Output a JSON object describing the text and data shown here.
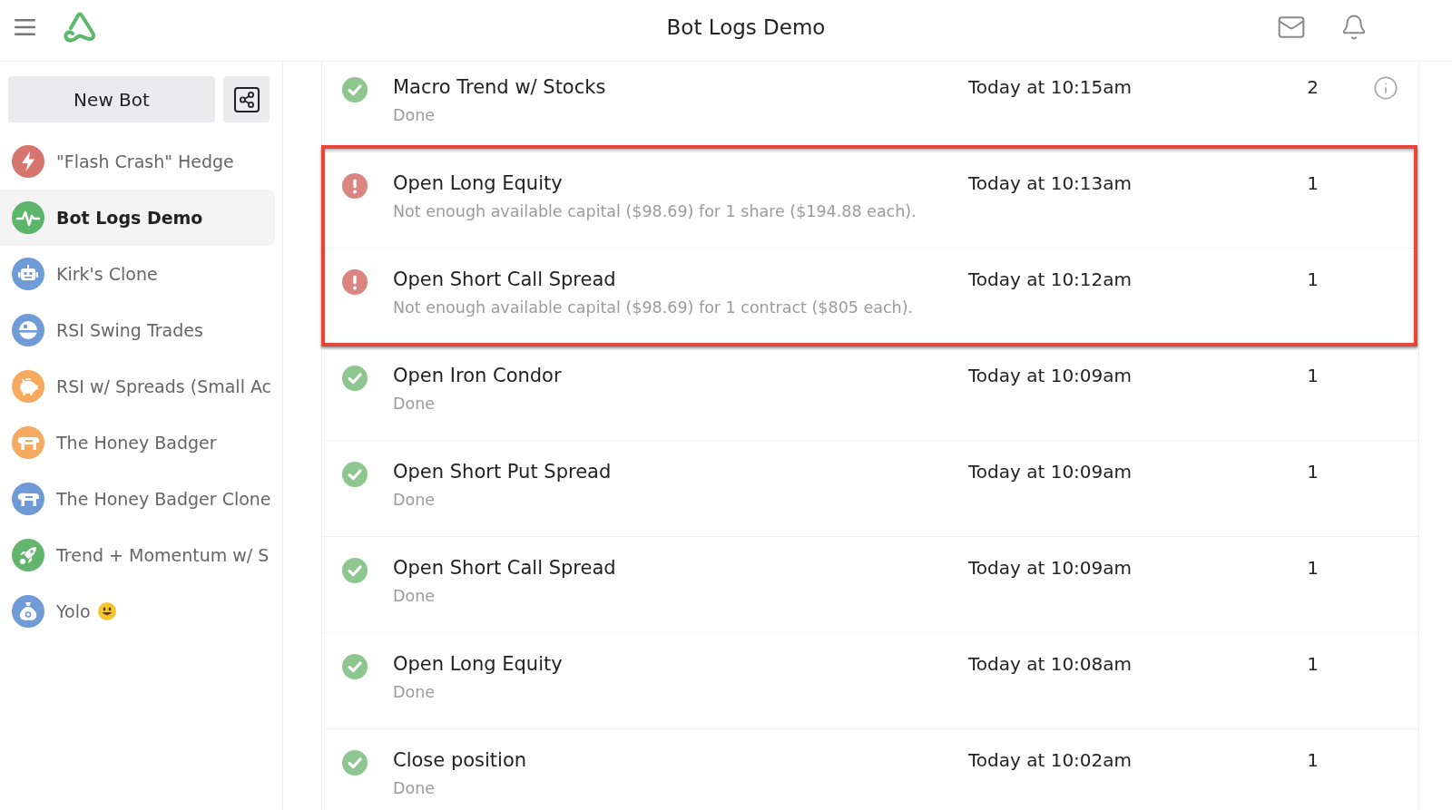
{
  "top_bar": {
    "title": "Bot Logs Demo"
  },
  "sidebar": {
    "new_bot_button": "New Bot",
    "items": [
      {
        "label": "\"Flash Crash\" Hedge",
        "kind": "bolt",
        "color": "#d6756d",
        "selected": false,
        "smiley": false
      },
      {
        "label": "Bot Logs Demo",
        "kind": "pulse",
        "color": "#5db56b",
        "selected": true,
        "smiley": false
      },
      {
        "label": "Kirk's Clone",
        "kind": "robot",
        "color": "#6f9bd6",
        "selected": false,
        "smiley": false
      },
      {
        "label": "RSI Swing Trades",
        "kind": "orb",
        "color": "#6f9bd7",
        "selected": false,
        "smiley": false
      },
      {
        "label": "RSI w/ Spreads (Small Ac",
        "kind": "piggy",
        "color": "#f6a95f",
        "selected": false,
        "smiley": false
      },
      {
        "label": "The Honey Badger",
        "kind": "animal",
        "color": "#f6a960",
        "selected": false,
        "smiley": false
      },
      {
        "label": "The Honey Badger Clone",
        "kind": "animal",
        "color": "#6f9ad6",
        "selected": false,
        "smiley": false
      },
      {
        "label": "Trend + Momentum w/ S",
        "kind": "rocket",
        "color": "#63b56d",
        "selected": false,
        "smiley": false
      },
      {
        "label": "Yolo",
        "kind": "bag",
        "color": "#709bd6",
        "selected": false,
        "smiley": true
      }
    ]
  },
  "log": {
    "rows": [
      {
        "kind": "done",
        "title": "Macro Trend w/ Stocks",
        "detail": "Done",
        "time": "Today at 10:15am",
        "count": "2",
        "info_button": true,
        "highlighted": false
      },
      {
        "kind": "error",
        "title": "Open Long Equity",
        "detail": "Not enough available capital ($98.69) for 1 share ($194.88 each).",
        "time": "Today at 10:13am",
        "count": "1",
        "info_button": false,
        "highlighted": true
      },
      {
        "kind": "error",
        "title": "Open Short Call Spread",
        "detail": "Not enough available capital ($98.69) for 1 contract ($805 each).",
        "time": "Today at 10:12am",
        "count": "1",
        "info_button": false,
        "highlighted": true
      },
      {
        "kind": "done",
        "title": "Open Iron Condor",
        "detail": "Done",
        "time": "Today at 10:09am",
        "count": "1",
        "info_button": false,
        "highlighted": false
      },
      {
        "kind": "done",
        "title": "Open Short Put Spread",
        "detail": "Done",
        "time": "Today at 10:09am",
        "count": "1",
        "info_button": false,
        "highlighted": false
      },
      {
        "kind": "done",
        "title": "Open Short Call Spread",
        "detail": "Done",
        "time": "Today at 10:09am",
        "count": "1",
        "info_button": false,
        "highlighted": false
      },
      {
        "kind": "done",
        "title": "Open Long Equity",
        "detail": "Done",
        "time": "Today at 10:08am",
        "count": "1",
        "info_button": false,
        "highlighted": false
      },
      {
        "kind": "done",
        "title": "Close position",
        "detail": "Done",
        "time": "Today at 10:02am",
        "count": "1",
        "info_button": false,
        "highlighted": false
      }
    ]
  }
}
